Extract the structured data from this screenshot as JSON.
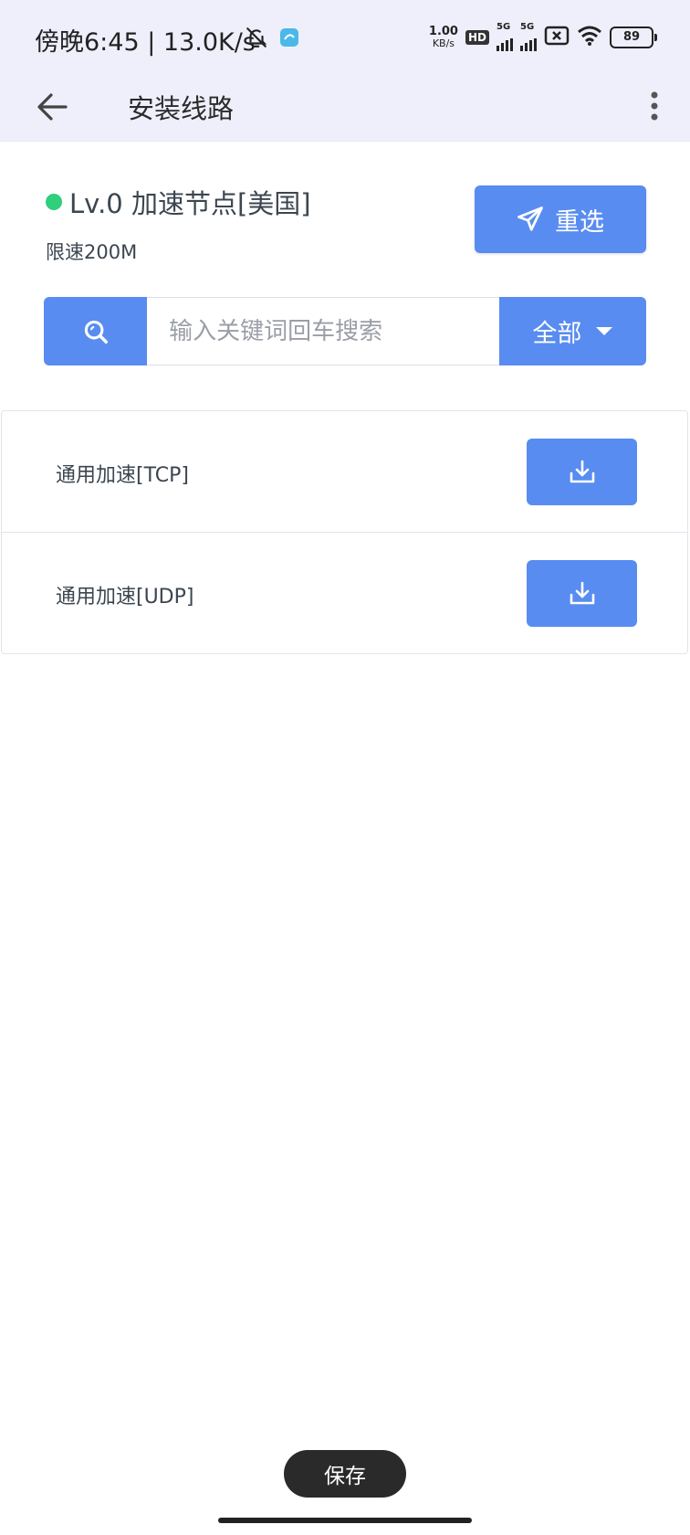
{
  "status_bar": {
    "time": "傍晚6:45 | 13.0K/s",
    "net_speed_value": "1.00",
    "net_speed_unit": "KB/s",
    "hd_label": "HD",
    "signal_1_label": "5G",
    "signal_2_label": "5G",
    "battery": "89"
  },
  "app_bar": {
    "title": "安装线路"
  },
  "node": {
    "name": "Lv.0 加速节点[美国]",
    "limit": "限速200M",
    "status_color": "#2fcf7c",
    "reselect_label": "重选"
  },
  "search": {
    "placeholder": "输入关键词回车搜索",
    "value": "",
    "filter_label": "全部"
  },
  "routes": [
    {
      "name": "通用加速[TCP]"
    },
    {
      "name": "通用加速[UDP]"
    }
  ],
  "toast": {
    "label": "保存"
  },
  "colors": {
    "accent": "#588cf0",
    "header_bg": "#eeeffb"
  }
}
